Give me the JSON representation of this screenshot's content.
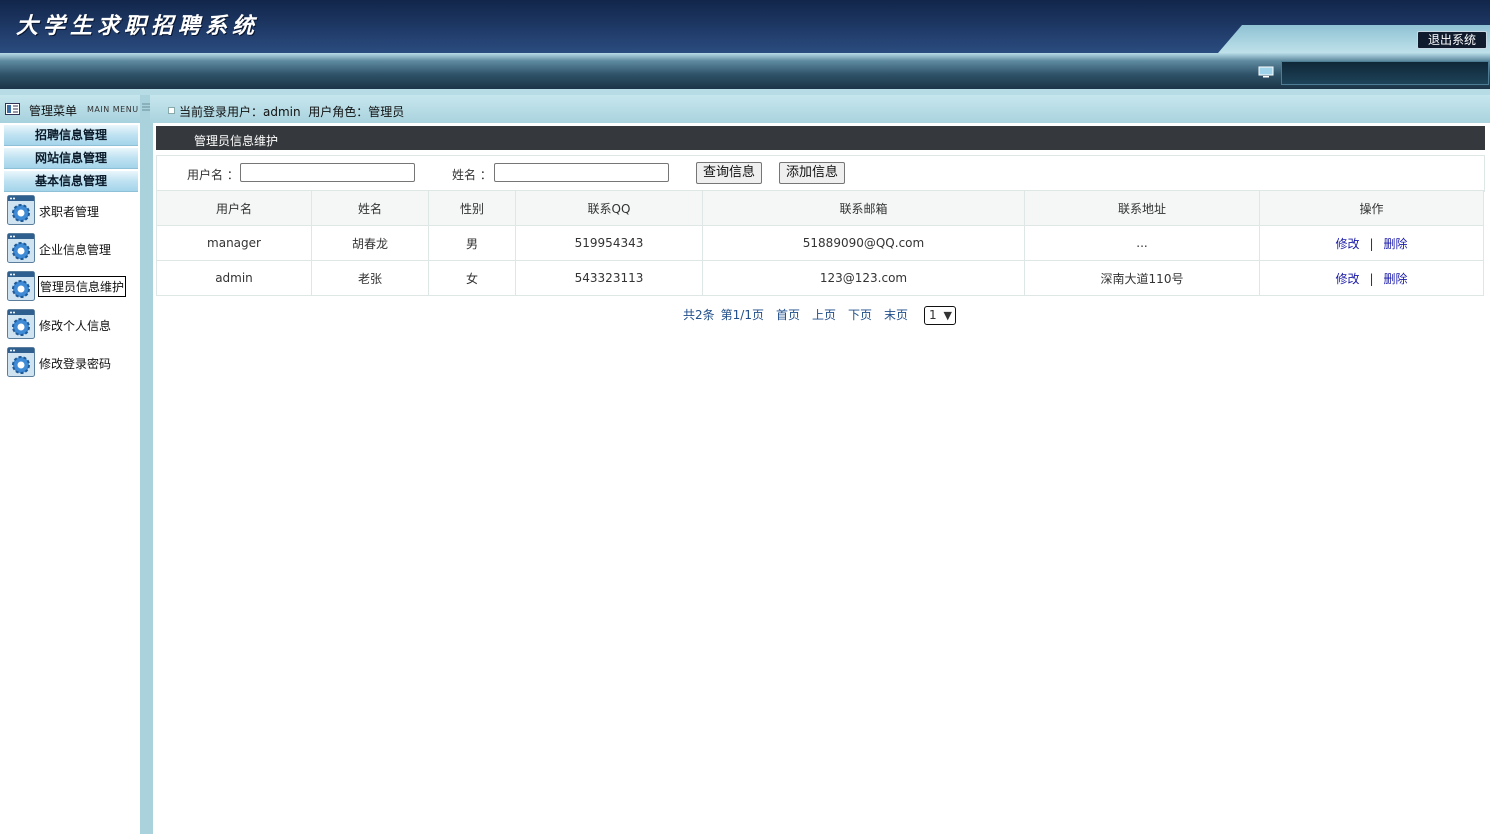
{
  "header": {
    "system_title": "大学生求职招聘系统",
    "logout_label": "退出系统"
  },
  "sidebar": {
    "title": "管理菜单",
    "subtitle": "MAIN MENU",
    "categories": [
      {
        "label": "招聘信息管理"
      },
      {
        "label": "网站信息管理"
      },
      {
        "label": "基本信息管理"
      }
    ],
    "items": [
      {
        "label": "求职者管理",
        "icon": "gear-icon"
      },
      {
        "label": "企业信息管理",
        "icon": "gear-icon"
      },
      {
        "label": "管理员信息维护",
        "icon": "gear-icon",
        "active": true
      },
      {
        "label": "修改个人信息",
        "icon": "gear-icon"
      },
      {
        "label": "修改登录密码",
        "icon": "gear-icon"
      }
    ]
  },
  "userbar": {
    "text": "当前登录用户：admin  用户角色：管理员"
  },
  "panel": {
    "title": "管理员信息维护"
  },
  "search": {
    "username_label": "用户名 ：",
    "username_value": "",
    "name_label": "姓名 ：",
    "name_value": "",
    "query_button": "查询信息",
    "add_button": "添加信息"
  },
  "table": {
    "headers": [
      "用户名",
      "姓名",
      "性别",
      "联系QQ",
      "联系邮箱",
      "联系地址",
      "操作"
    ],
    "rows": [
      {
        "username": "manager",
        "name": "胡春龙",
        "gender": "男",
        "qq": "519954343",
        "email": "51889090@QQ.com",
        "address": "..."
      },
      {
        "username": "admin",
        "name": "老张",
        "gender": "女",
        "qq": "543323113",
        "email": "123@123.com",
        "address": "深南大道110号"
      }
    ],
    "edit_label": "修改",
    "separator": "|",
    "delete_label": "删除"
  },
  "pager": {
    "total": "共2条",
    "page_info": "第1/1页",
    "first": "首页",
    "prev": "上页",
    "next": "下页",
    "last": "末页",
    "selected_page": "1"
  },
  "colors": {
    "banner": "#1f3a68",
    "panel_title_bg": "#35383c",
    "link": "#1a1aa8",
    "sidebar_bg": "#a9d2dd"
  }
}
